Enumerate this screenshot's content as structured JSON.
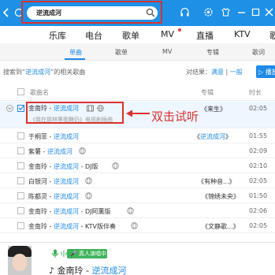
{
  "search": {
    "query": "逆流成河"
  },
  "nav": {
    "items": [
      "乐库",
      "电台",
      "歌单",
      "MV",
      "直播",
      "KTV",
      "歌"
    ]
  },
  "subtabs": [
    "单曲",
    "歌单",
    "MV",
    "专辑",
    "歌词"
  ],
  "info": {
    "prefix": "搜索到“",
    "keyword": "逆流成河",
    "suffix": "”的相关歌曲",
    "compare_label": "对结果：",
    "full_link": "满意",
    "neutral_link": "一般",
    "play_all": "播放"
  },
  "list_header": {
    "name": "歌曲名",
    "album": "专辑",
    "duration": "时长"
  },
  "expanded": {
    "artist": "金南玲 - ",
    "song": "逆流成河",
    "sub": "《我在那林等歌舞仍》电视剧插曲",
    "album": "《来生》",
    "duration": "02:05",
    "annotation": "双击试听"
  },
  "rows": [
    {
      "artist": "于桐菲 - ",
      "song": "逆流成河",
      "extra": "",
      "album_prefix": "《",
      "album": "逆流成河",
      "album_suffix": "》",
      "duration": "01:55"
    },
    {
      "artist": "紫薯 - ",
      "song": "逆流成河",
      "extra": "",
      "album_prefix": "",
      "album": "",
      "album_suffix": "",
      "duration": "02:09"
    },
    {
      "artist": "金南玲 - ",
      "song": "逆流成河",
      "extra": " - DJ版",
      "album_prefix": "",
      "album": "",
      "album_suffix": "",
      "duration": "02:10"
    },
    {
      "artist": "白银河 - ",
      "song": "逆流成河",
      "extra": "",
      "album_prefix": "",
      "album": "《有种音...》",
      "album_suffix": "",
      "duration": "02:05"
    },
    {
      "artist": "陈都灵 - ",
      "song": "逆流成河",
      "extra": "",
      "album_prefix": "",
      "album": "《锦绣未央》",
      "album_suffix": "",
      "duration": "01:50"
    },
    {
      "artist": "金南玲 - ",
      "song": "逆流成河",
      "extra": " - DJ阿薰版",
      "album_prefix": "",
      "album": "",
      "album_suffix": "",
      "duration": "02:06"
    },
    {
      "artist": "金南玲 - ",
      "song": "逆流成河",
      "extra": " - KTV版伴奏",
      "album_prefix": "",
      "album": "《文静歌...》",
      "album_suffix": "",
      "duration": "02:05"
    }
  ],
  "player": {
    "live_label": "真人演唱中",
    "artist": "金南玲 - ",
    "song": "逆流成河"
  },
  "colors": {
    "topbar": "#1e90e6",
    "accent": "#1e8ae6",
    "annotation_red": "#d8312d",
    "live_green": "#3fb35a"
  }
}
